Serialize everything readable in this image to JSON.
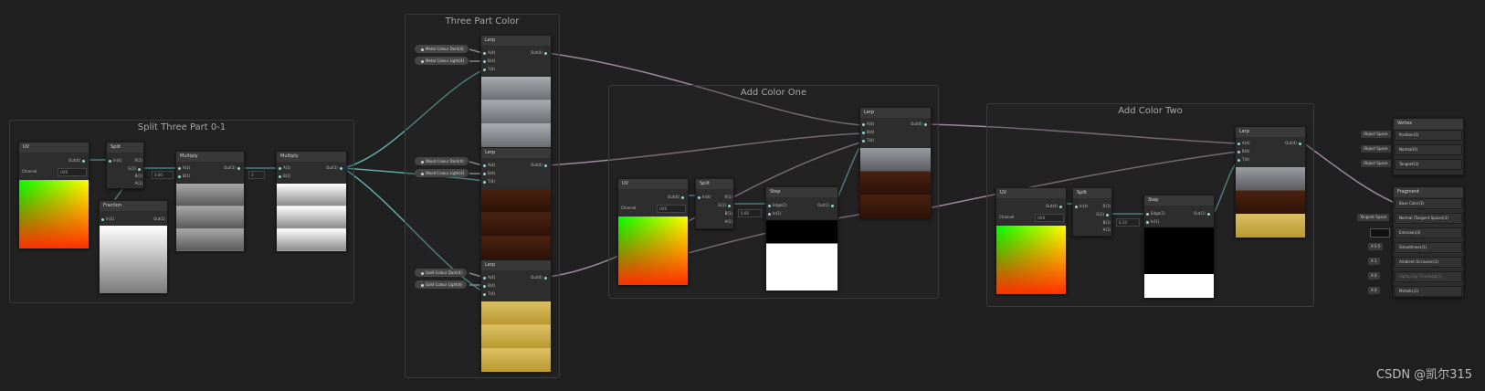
{
  "groups": {
    "split": "Split Three Part 0-1",
    "three_part": "Three Part Color",
    "add_one": "Add Color One",
    "add_two": "Add Color Two"
  },
  "nodes": {
    "uv": "UV",
    "uv_out": "Out(4)",
    "uv_channel": "Channel",
    "uv_channel_val": "UV0",
    "split": "Split",
    "split_in": "In(4)",
    "split_r": "R(1)",
    "split_g": "G(1)",
    "split_b": "B(1)",
    "split_a": "A(1)",
    "fraction": "Fraction",
    "fraction_in": "In(1)",
    "fraction_out": "Out(1)",
    "multiply1": "Multiply",
    "multiply2": "Multiply",
    "mult_a": "A(1)",
    "mult_b": "B(1)",
    "mult_out": "Out(1)",
    "mult_b_val1": "3.00",
    "mult_b_val2": "3",
    "lerp": "Lerp",
    "lerp_a": "A(4)",
    "lerp_b": "B(4)",
    "lerp_t": "T(4)",
    "lerp_out": "Out(4)",
    "step": "Step",
    "step_edge": "Edge(1)",
    "step_in": "In(1)",
    "step_out": "Out(1)",
    "step_edge_val": "0.66",
    "step2_edge_val": "0.33"
  },
  "properties": {
    "metal_dark": "Metal Colour Dark(4)",
    "metal_light": "Metal Colour Light(4)",
    "wood_dark": "Wood Colour Dark(4)",
    "wood_light": "Wood Colour Light(4)",
    "gold_dark": "Gold Colour Dark(4)",
    "gold_light": "Gold Colour Light(4)"
  },
  "master": {
    "vertex_title": "Vertex",
    "vertex_rows": [
      "Position(3)",
      "Normal(3)",
      "Tangent(3)"
    ],
    "vertex_tags": [
      "Object Space",
      "Object Space",
      "Object Space"
    ],
    "fragment_title": "Fragment",
    "fragment_rows": [
      "Base Color(3)",
      "Normal (Tangent Space)(3)",
      "Emission(3)",
      "Smoothness(1)",
      "Ambient Occlusion(1)",
      "Alpha Clip Threshold(1)",
      "Metallic(1)"
    ],
    "fragment_tags": [
      "",
      "Tangent Space",
      "",
      "X 0.5",
      "X 1",
      "X 0",
      "X 0"
    ]
  },
  "colors": {
    "wire_teal": "#5fa9a6",
    "wire_purple": "#9c8a9c",
    "background": "#202020"
  },
  "watermark": "CSDN @凯尔315"
}
